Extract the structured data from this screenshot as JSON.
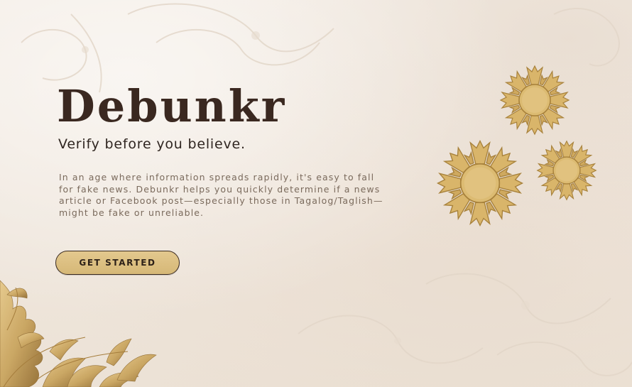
{
  "hero": {
    "title": "Debunkr",
    "tagline": "Verify before you believe.",
    "description": "In an age where information spreads rapidly, it's easy to fall for fake news. Debunkr helps you quickly determine if a news article or Facebook post—especially those in Tagalog/Taglish—might be fake or unreliable."
  },
  "cta": {
    "label": "GET STARTED"
  },
  "decor": {
    "sun_icon": "philippine-sun-icon",
    "foliage_icon": "gold-foliage-icon",
    "gold": "#d9b56a",
    "gold_dark": "#a8823c"
  },
  "colors": {
    "background": "#f1e9e0",
    "title": "#3a2820",
    "body_text": "#7a6a5c",
    "button": "#dcbf82"
  }
}
